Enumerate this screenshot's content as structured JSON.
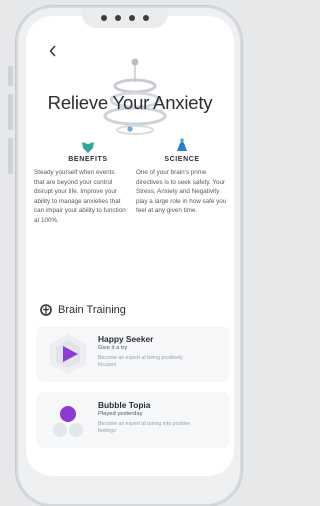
{
  "screen": {
    "title": "Relieve Your Anxiety",
    "back_icon": "chevron-left-icon"
  },
  "benefits": {
    "heading": "BENEFITS",
    "icon": "heart-shield-icon",
    "text": "Steady yourself when events that are beyond your control disrupt your life. Improve your ability to manage anxieties that can impair your ability to function at 100%."
  },
  "science": {
    "heading": "SCIENCE",
    "icon": "flask-icon",
    "text": "One of your brain's prime directives is to seek safety. Your Stress, Anxiety and Negativity play a large role in how safe you feel at any given time."
  },
  "brain_training": {
    "title": "Brain Training",
    "icon": "brain-icon",
    "items": [
      {
        "name": "Happy Seeker",
        "status": "Give it a try",
        "description": "Become an expert at being positively focused",
        "accent": "#8e3bd6"
      },
      {
        "name": "Bubble Topia",
        "status": "Played yesterday",
        "description": "Become an expert at tuning into positive feelings",
        "accent": "#8e3bd6"
      }
    ]
  },
  "colors": {
    "accent_purple": "#8e3bd6",
    "accent_teal": "#2ea79a",
    "text_dark": "#2b2e33"
  }
}
